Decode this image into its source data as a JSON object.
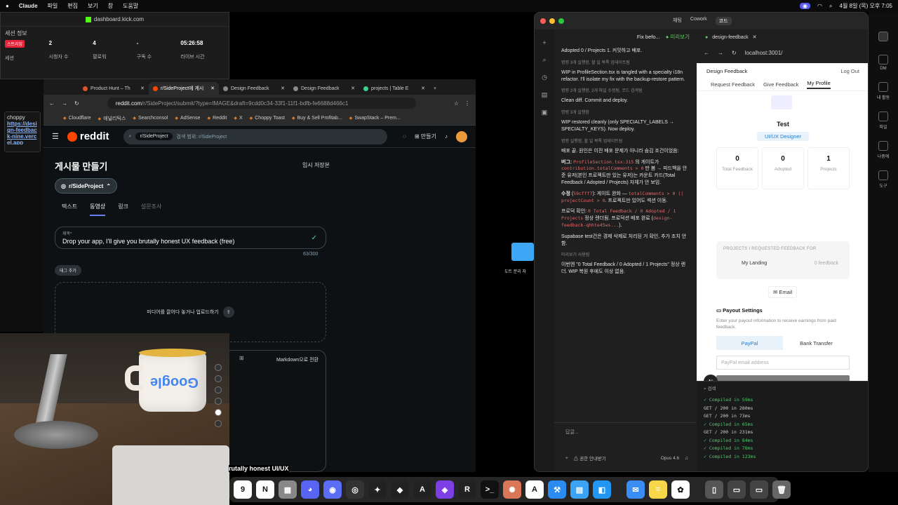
{
  "menubar": {
    "app": "Claude",
    "items": [
      "파일",
      "편집",
      "보기",
      "창",
      "도움말"
    ],
    "datetime": "4월 8일 (목) 오후 7:05"
  },
  "kick": {
    "title": "dashboard.kick.com",
    "section": "세션 정보",
    "live_badge": "스트리밍",
    "stats": [
      {
        "value": "",
        "label": "세션"
      },
      {
        "value": "2",
        "label": "시청자 수"
      },
      {
        "value": "4",
        "label": "팔로워"
      },
      {
        "value": "-",
        "label": "구독 수"
      },
      {
        "value": "05:26:58",
        "label": "라이브 시간"
      }
    ]
  },
  "sidecard": {
    "title": "choppy",
    "link": "https://design-feedback-nine.vercel.app"
  },
  "chrome": {
    "tabs": [
      "Product Hunt – Th",
      "r/SideProject에 게시",
      "Design Feedback",
      "Design Feedback",
      "projects | Table E"
    ],
    "url_host": "reddit.com",
    "url_path": "/r/SideProject/submit/?type=IMAGE&draft=9cdd0c34-33f1-11f1-bdfb-fe6688d466c1",
    "bookmarks": [
      "Cloudflare",
      "애널리틱스",
      "Searchconsol",
      "AdSense",
      "Reddit",
      "X",
      "Choppy Toast",
      "Buy & Sell Profitab...",
      "SwapStack – Prem..."
    ]
  },
  "reddit": {
    "logo": "reddit",
    "search_chip": "r/SideProject",
    "search_placeholder": "검색 범위: r/SideProject",
    "create": "만들기",
    "page_title": "게시물 만들기",
    "drafts": "임시 저장본",
    "community": "r/SideProject",
    "tabs": [
      "텍스트",
      "동영상",
      "링크",
      "설문조사"
    ],
    "title_label": "제목*",
    "title_value": "Drop your app, I'll give you brutally honest UX feedback (free)",
    "count": "63/300",
    "tag_button": "태그 추가",
    "drop_text": "미디어를 끌어다 놓거나 업로드하기",
    "markdown": "Markdown으로 전환",
    "overflow_text": "rutally honest UI/UX"
  },
  "desktop_folder": "도트 분리 자",
  "claude": {
    "segments": [
      "채팅",
      "Cowork",
      "코드"
    ],
    "header_title": "Fix befo...",
    "header_mode": "미리보기",
    "messages": [
      {
        "type": "text",
        "text": "Adopted 0 / Projects 1. 커밋하고 배포."
      },
      {
        "type": "meta",
        "text": "명령 3개 실행함, 할 일 목록 업데이트됨"
      },
      {
        "type": "text",
        "text": "WIP in ProfileSection.tsx is tangled with a specialty i18n refactor. I'll isolate my fix with the backup-restore pattern."
      },
      {
        "type": "meta",
        "text": "명령 2개 실행함, 2개 파일 수정됨, 코드 검색됨"
      },
      {
        "type": "text",
        "text": "Clean diff. Commit and deploy."
      },
      {
        "type": "meta",
        "text": "명령 3개 실행함"
      },
      {
        "type": "text",
        "text": "WIP restored cleanly (only SPECIALTY_LABELS → SPECIALTY_KEYS). Now deploy."
      },
      {
        "type": "meta",
        "text": "명령 실행함, 할 일 목록 업데이트됨"
      },
      {
        "type": "text",
        "text": "배포 끝. 원인은 이전 배포 문제가 아니라 숨김 조건이었음:"
      }
    ],
    "bug_label": "버그:",
    "bug_code1": "ProfileSection.tsx:315",
    "bug_text1": "의 게이트가",
    "bug_code2": "contribution.totalComments > 0",
    "bug_text2": "만 봄 → 피드백을 안 준 유저(본인 프로젝트만 있는 유저)는 카운트 카드(Total Feedback / Adopted / Projects) 자체가 안 보임.",
    "fix_label": "수정",
    "fix_commit": "59cfff7",
    "fix_text1": "): 게이트 완화 —",
    "fix_code": "totalComments > 0 || projectCount > 0",
    "fix_text2": ". 프로젝트만 있어도 섹션 이동.",
    "prod_label": "프로덕 확인:",
    "prod_code": "0 Total Feedback / 0 Adopted / 1 Projects",
    "prod_text": "정상 렌더됨. 프로덕션 배포 완료 (",
    "prod_code2": "design-feedback-qhhte45ws...",
    "prod_text2": ").",
    "supabase": "Supabase test건은 경제 삭제로 처리된 거 확인, 추가 조치 안 함.",
    "preview_meta": "미리보기 사용됨",
    "final": "이번엔 \"0 Total Feedback / 0 Adopted / 1 Projects\" 정상 렌더. WIP 복원 후에도 이상 없음.",
    "input_placeholder": "답글...",
    "input_perm": "권한 안내받기",
    "input_model": "Opus 4.6"
  },
  "preview": {
    "tab": "design-feedback",
    "url": "localhost:3001/",
    "app_title": "Design Feedback",
    "logout": "Log Out",
    "nav": [
      "Request Feedback",
      "Give Feedback",
      "My Profile"
    ],
    "name": "Test",
    "role": "UI/UX Designer",
    "stats": [
      {
        "n": "0",
        "l": "Total Feedback"
      },
      {
        "n": "0",
        "l": "Adopted"
      },
      {
        "n": "1",
        "l": "Projects"
      }
    ],
    "projects_header": "PROJECTS I REQUESTED FEEDBACK FOR",
    "project_name": "My Landing",
    "project_feedback": "0 feedback",
    "email": "Email",
    "payout_title": "Payout Settings",
    "payout_desc": "Enter your payout information to receive earnings from paid feedback.",
    "paypal": "PayPal",
    "bank": "Bank Transfer",
    "email_placeholder": "PayPal email address",
    "save": "Save",
    "fab": "N"
  },
  "terminal": {
    "search": "검색",
    "lines": [
      {
        "kind": "ok",
        "text": "✓ Compiled in 59ms"
      },
      {
        "kind": "get",
        "text": "GET / 200 in 280ms"
      },
      {
        "kind": "get",
        "text": "GET / 200 in 73ms"
      },
      {
        "kind": "ok",
        "text": "✓ Compiled in 65ms"
      },
      {
        "kind": "get",
        "text": "GET / 200 in 231ms"
      },
      {
        "kind": "ok",
        "text": "✓ Compiled in 84ms"
      },
      {
        "kind": "ok",
        "text": "✓ Compiled in 78ms"
      },
      {
        "kind": "ok",
        "text": "✓ Compiled in 123ms"
      }
    ]
  },
  "right_dock": [
    "DM",
    "내 활동",
    "파일",
    "나중에",
    "도구"
  ],
  "dock_apps": [
    "Calendar",
    "Notion",
    "Calculator",
    "Discord",
    "Messenger",
    "Chrome Canary",
    "Figma",
    "Cursor",
    "Arc",
    "Perplexity",
    "Raycast",
    "Terminal",
    "Claude",
    "Dictionary",
    "Xcode",
    "Files",
    "Setapp",
    "Mail",
    "Notes",
    "ChatGPT",
    "Preview",
    "Screens",
    "Trash"
  ]
}
